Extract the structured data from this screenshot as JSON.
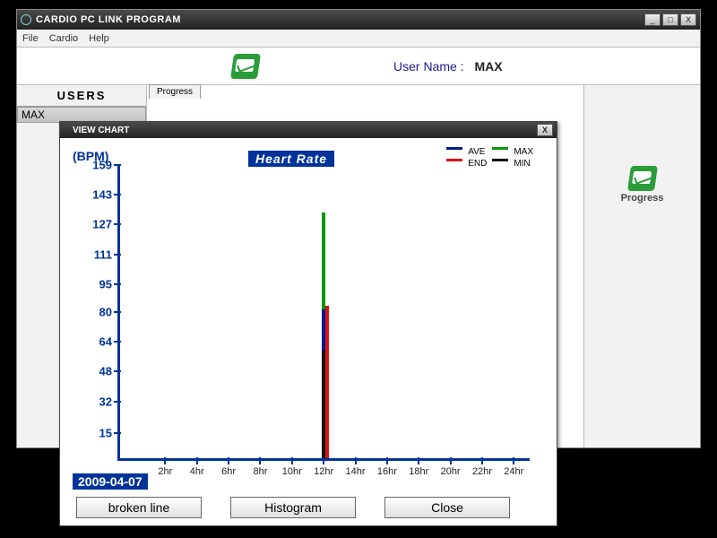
{
  "main_window": {
    "title": "CARDIO PC LINK PROGRAM",
    "menu": {
      "file": "File",
      "cardio": "Cardio",
      "help": "Help"
    },
    "username_label": "User Name :",
    "username_value": "MAX",
    "users_header": "USERS",
    "users": [
      "MAX"
    ],
    "tab": "Progress",
    "right_label": "Progress"
  },
  "chart_window": {
    "title": "VIEW CHART",
    "date": "2009-04-07",
    "buttons": {
      "broken": "broken line",
      "histogram": "Histogram",
      "close": "Close"
    }
  },
  "chart_data": {
    "type": "bar",
    "title": "Heart Rate",
    "ylabel": "(BPM)",
    "ylim": [
      0,
      159
    ],
    "y_ticks": [
      15,
      32,
      48,
      64,
      80,
      95,
      111,
      127,
      143,
      159
    ],
    "x_categories": [
      "2hr",
      "4hr",
      "6hr",
      "8hr",
      "10hr",
      "12hr",
      "14hr",
      "16hr",
      "18hr",
      "20hr",
      "22hr",
      "24hr"
    ],
    "legend": [
      {
        "name": "AVE",
        "color": "#001a8a"
      },
      {
        "name": "MAX",
        "color": "#0a9a0a"
      },
      {
        "name": "END",
        "color": "#e01010"
      },
      {
        "name": "MIN",
        "color": "#111111"
      }
    ],
    "series": [
      {
        "name": "AVE",
        "color": "#001a8a",
        "values": [
          null,
          null,
          null,
          null,
          null,
          80,
          null,
          null,
          null,
          null,
          null,
          null
        ]
      },
      {
        "name": "MAX",
        "color": "#0a9a0a",
        "values": [
          null,
          null,
          null,
          null,
          null,
          132,
          null,
          null,
          null,
          null,
          null,
          null
        ]
      },
      {
        "name": "END",
        "color": "#e01010",
        "values": [
          null,
          null,
          null,
          null,
          null,
          82,
          null,
          null,
          null,
          null,
          null,
          null
        ]
      },
      {
        "name": "MIN",
        "color": "#111111",
        "values": [
          null,
          null,
          null,
          null,
          null,
          58,
          null,
          null,
          null,
          null,
          null,
          null
        ]
      }
    ]
  }
}
